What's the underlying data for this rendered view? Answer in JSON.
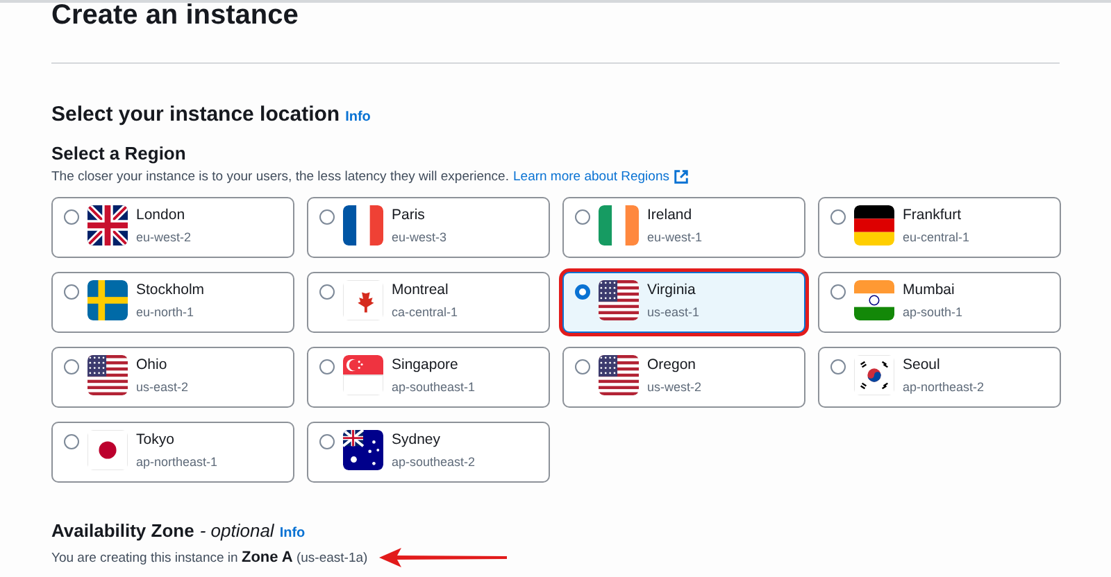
{
  "page_title": "Create an instance",
  "location": {
    "heading": "Select your instance location",
    "info": "Info"
  },
  "region": {
    "heading": "Select a Region",
    "description": "The closer your instance is to your users, the less latency they will experience.",
    "learn_more": "Learn more about Regions"
  },
  "regions": [
    {
      "name": "London",
      "code": "eu-west-2",
      "kind": "uk",
      "selected": false,
      "highlighted": false
    },
    {
      "name": "Paris",
      "code": "eu-west-3",
      "kind": "fr",
      "selected": false,
      "highlighted": false
    },
    {
      "name": "Ireland",
      "code": "eu-west-1",
      "kind": "ie",
      "selected": false,
      "highlighted": false
    },
    {
      "name": "Frankfurt",
      "code": "eu-central-1",
      "kind": "de",
      "selected": false,
      "highlighted": false
    },
    {
      "name": "Stockholm",
      "code": "eu-north-1",
      "kind": "se",
      "selected": false,
      "highlighted": false
    },
    {
      "name": "Montreal",
      "code": "ca-central-1",
      "kind": "ca",
      "selected": false,
      "highlighted": false
    },
    {
      "name": "Virginia",
      "code": "us-east-1",
      "kind": "us",
      "selected": true,
      "highlighted": true
    },
    {
      "name": "Mumbai",
      "code": "ap-south-1",
      "kind": "in",
      "selected": false,
      "highlighted": false
    },
    {
      "name": "Ohio",
      "code": "us-east-2",
      "kind": "us",
      "selected": false,
      "highlighted": false
    },
    {
      "name": "Singapore",
      "code": "ap-southeast-1",
      "kind": "sg",
      "selected": false,
      "highlighted": false
    },
    {
      "name": "Oregon",
      "code": "us-west-2",
      "kind": "us",
      "selected": false,
      "highlighted": false
    },
    {
      "name": "Seoul",
      "code": "ap-northeast-2",
      "kind": "kr",
      "selected": false,
      "highlighted": false
    },
    {
      "name": "Tokyo",
      "code": "ap-northeast-1",
      "kind": "jp",
      "selected": false,
      "highlighted": false
    },
    {
      "name": "Sydney",
      "code": "ap-southeast-2",
      "kind": "au",
      "selected": false,
      "highlighted": false
    }
  ],
  "availability": {
    "heading": "Availability Zone",
    "optional": "- optional",
    "info": "Info",
    "sentence": "You are creating this instance in **Zone A** (us-east-1a)"
  }
}
